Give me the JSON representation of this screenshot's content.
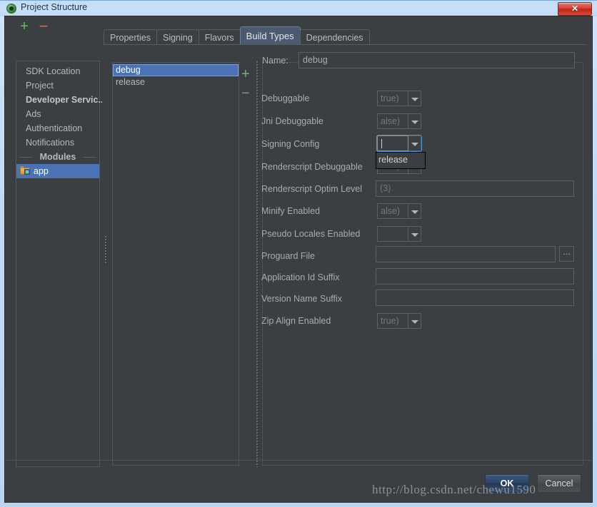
{
  "window": {
    "title": "Project Structure",
    "app_icon": "android-studio-icon",
    "close_label": "✕"
  },
  "toolbar": {
    "add_label": "+",
    "remove_label": "−"
  },
  "tabs": [
    {
      "label": "Properties",
      "selected": false
    },
    {
      "label": "Signing",
      "selected": false
    },
    {
      "label": "Flavors",
      "selected": false
    },
    {
      "label": "Build Types",
      "selected": true
    },
    {
      "label": "Dependencies",
      "selected": false
    }
  ],
  "sidebar": {
    "items": [
      {
        "label": "SDK Location",
        "type": "item"
      },
      {
        "label": "Project",
        "type": "item"
      },
      {
        "label": "Developer Servic...",
        "type": "bold-item"
      },
      {
        "label": "Ads",
        "type": "item"
      },
      {
        "label": "Authentication",
        "type": "item"
      },
      {
        "label": "Notifications",
        "type": "item"
      },
      {
        "label": "Modules",
        "type": "group-header"
      },
      {
        "label": "app",
        "type": "module",
        "selected": true
      }
    ]
  },
  "buildtypes": {
    "items": [
      {
        "label": "debug",
        "selected": true
      },
      {
        "label": "release",
        "selected": false
      }
    ],
    "add_label": "+",
    "remove_label": "−"
  },
  "detail": {
    "name_label": "Name:",
    "name_value": "debug",
    "fields": [
      {
        "label": "Debuggable",
        "kind": "combo",
        "value": "true)"
      },
      {
        "label": "Jni Debuggable",
        "kind": "combo",
        "value": "alse)"
      },
      {
        "label": "Signing Config",
        "kind": "combo",
        "value": "",
        "focused": true
      },
      {
        "label": "Renderscript Debuggable",
        "kind": "combo",
        "value": "alse)"
      },
      {
        "label": "Renderscript Optim Level",
        "kind": "text",
        "value": "(3)"
      },
      {
        "label": "Minify Enabled",
        "kind": "combo",
        "value": "alse)"
      },
      {
        "label": "Pseudo Locales Enabled",
        "kind": "combo",
        "value": ""
      },
      {
        "label": "Proguard File",
        "kind": "text-browse",
        "value": ""
      },
      {
        "label": "Application Id Suffix",
        "kind": "text",
        "value": ""
      },
      {
        "label": "Version Name Suffix",
        "kind": "text",
        "value": ""
      },
      {
        "label": "Zip Align Enabled",
        "kind": "combo",
        "value": "true)"
      }
    ],
    "browse_label": "...",
    "signing_dropdown": {
      "open": true,
      "options": [
        "release"
      ]
    }
  },
  "footer": {
    "ok_label": "OK",
    "cancel_label": "Cancel"
  },
  "watermark": "http://blog.csdn.net/chewu1590",
  "colors": {
    "dialog_bg": "#3c3f41",
    "selection_blue": "#4a72b5",
    "tab_selected": "#4a5a72",
    "focus_blue": "#4b8ed8",
    "accent_green": "#5fbf5f",
    "titlebar": "#c9e0f9"
  }
}
